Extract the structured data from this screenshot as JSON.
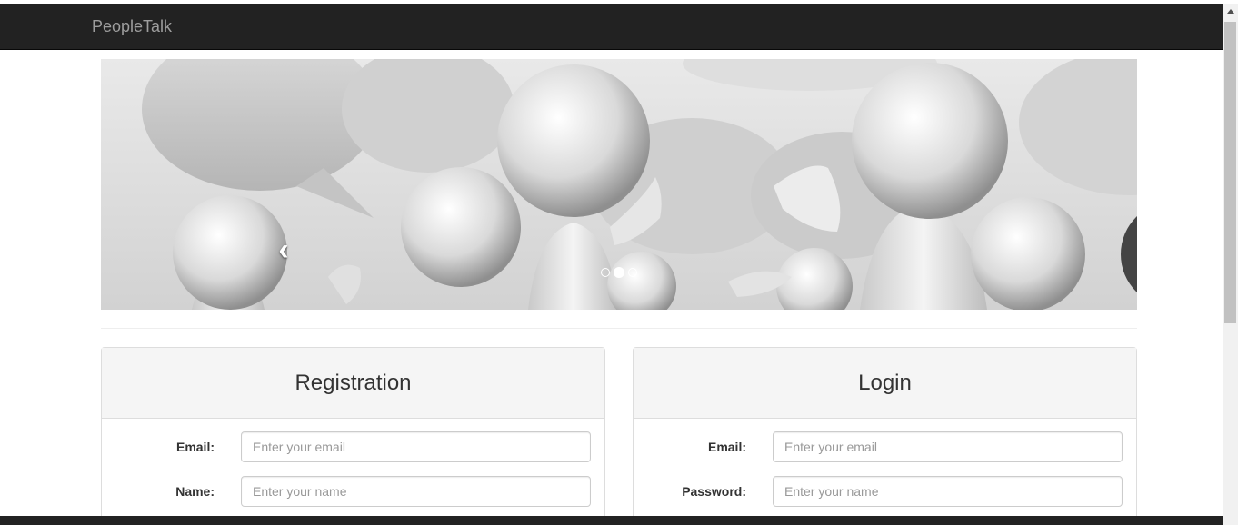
{
  "navbar": {
    "brand": "PeopleTalk"
  },
  "carousel": {
    "prev_icon": "chevron-left-icon",
    "next_icon": "chevron-right-icon",
    "slide_count": 3,
    "active_slide": 2,
    "prev_glyph": "‹",
    "next_glyph": "›"
  },
  "registration": {
    "title": "Registration",
    "email_label": "Email:",
    "email_placeholder": "Enter your email",
    "name_label": "Name:",
    "name_placeholder": "Enter your name"
  },
  "login": {
    "title": "Login",
    "email_label": "Email:",
    "email_placeholder": "Enter your email",
    "password_label": "Password:",
    "password_placeholder": "Enter your name"
  },
  "colors": {
    "navbar_bg": "#222222",
    "brand_text": "#9d9d9d",
    "panel_heading_bg": "#f5f5f5"
  }
}
